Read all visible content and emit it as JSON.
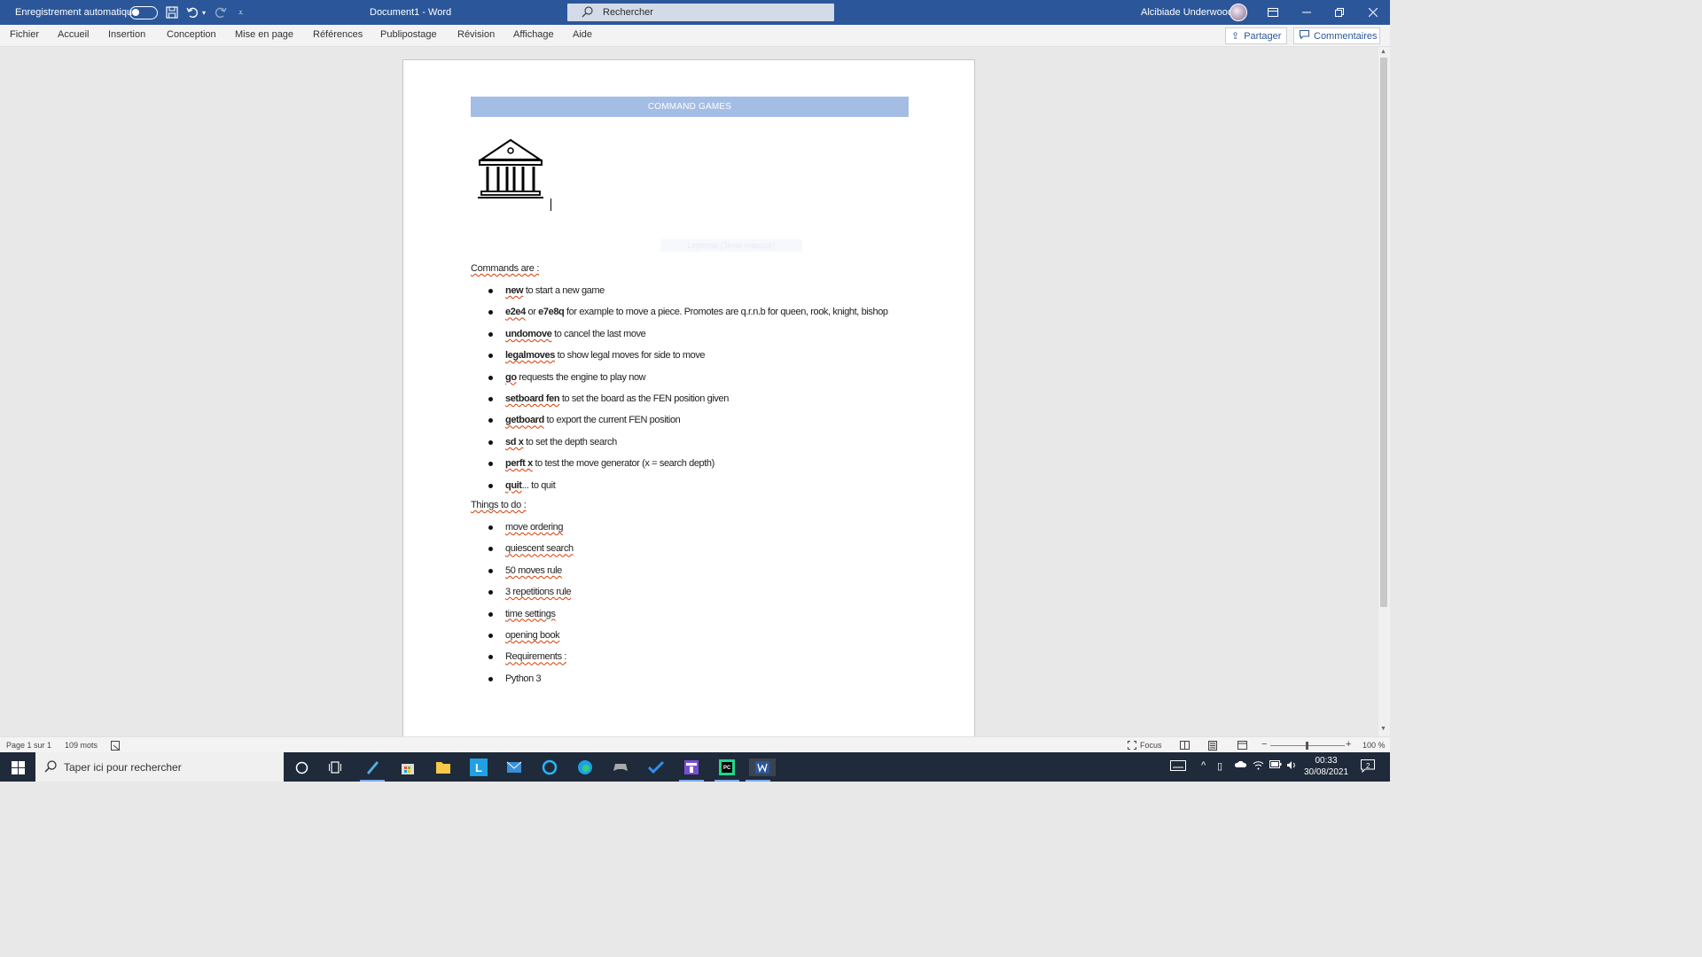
{
  "titlebar": {
    "autosave_label": "Enregistrement automatique",
    "doc_title": "Document1  -  Word",
    "search_placeholder": "Rechercher",
    "user_name": "Alcibiade Underwood"
  },
  "ribbon": {
    "tabs": [
      "Fichier",
      "Accueil",
      "Insertion",
      "Conception",
      "Mise en page",
      "Références",
      "Publipostage",
      "Révision",
      "Affichage",
      "Aide"
    ],
    "share_label": "Partager",
    "comments_label": "Commentaires"
  },
  "document": {
    "banner": "COMMAND GAMES",
    "faint_text": "Légende (Texte masqué)",
    "commands_heading": "Commands are :",
    "commands": [
      {
        "cmd": "new",
        "rest": " to start a new game"
      },
      {
        "cmd": "e2e4",
        "mid": " or ",
        "cmd2": "e7e8q",
        "rest": " for example to move a piece. Promotes are q.r.n.b for queen, rook, knight, bishop"
      },
      {
        "cmd": "undomove",
        "rest": " to cancel the last move"
      },
      {
        "cmd": "legalmoves",
        "rest": " to show legal moves for side to move"
      },
      {
        "cmd": "go",
        "rest": " requests the engine to play now"
      },
      {
        "cmd": "setboard fen",
        "rest": " to set the board as the FEN position given"
      },
      {
        "cmd": "getboard",
        "rest": " to export the current FEN position"
      },
      {
        "cmd": "sd x",
        "rest": " to set the depth search"
      },
      {
        "cmd": "perft x",
        "rest": " to test the move generator (x = search depth)"
      },
      {
        "cmd": "quit",
        "rest": "... to quit"
      }
    ],
    "todo_heading": "Things to do :",
    "todo": [
      "move ordering",
      "quiescent search",
      "50 moves rule",
      "3 repetitions rule",
      "time settings",
      "opening book",
      "Requirements :",
      "Python 3"
    ]
  },
  "statusbar": {
    "page": "Page 1 sur 1",
    "words": "109 mots",
    "focus": "Focus",
    "zoom": "100 %"
  },
  "taskbar": {
    "search_placeholder": "Taper ici pour rechercher",
    "time": "00:33",
    "date": "30/08/2021",
    "notif_count": "2"
  }
}
